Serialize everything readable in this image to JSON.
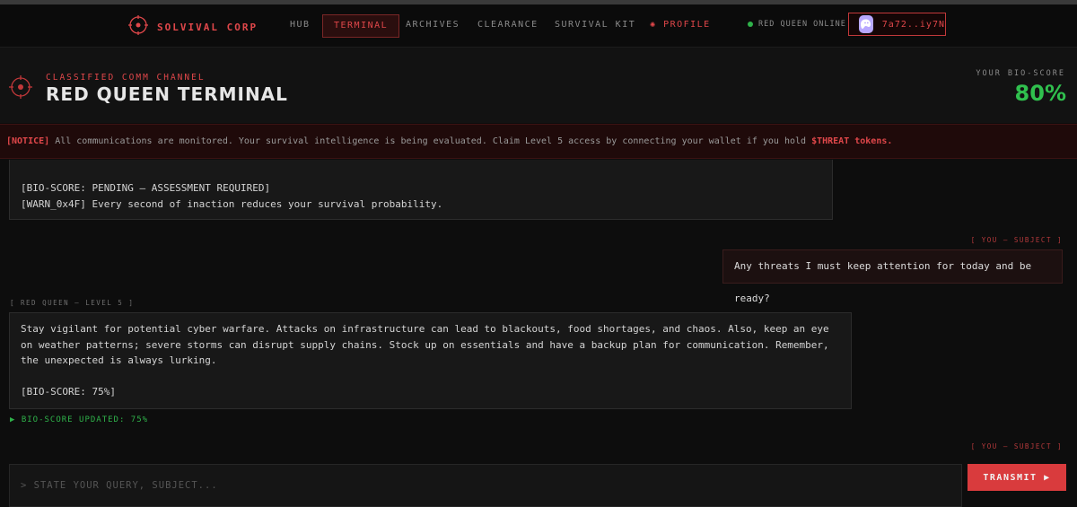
{
  "brand": {
    "name": "SOLVIVAL CORP"
  },
  "nav": {
    "items": [
      {
        "label": "HUB"
      },
      {
        "label": "TERMINAL"
      },
      {
        "label": "ARCHIVES"
      },
      {
        "label": "CLEARANCE"
      },
      {
        "label": "SURVIVAL KIT"
      },
      {
        "label": "PROFILE"
      }
    ],
    "active": "TERMINAL",
    "status": "RED QUEEN ONLINE",
    "wallet": "7a72..iy7N"
  },
  "header": {
    "subtitle": "CLASSIFIED COMM CHANNEL",
    "title": "RED QUEEN TERMINAL",
    "bio_label": "YOUR BIO-SCORE",
    "bio_value": "80%"
  },
  "notice": {
    "tag": "[NOTICE]",
    "text": " All communications are monitored. Your survival intelligence is being evaluated. Claim Level 5 access by connecting your wallet if you hold ",
    "token": "$THREAT tokens."
  },
  "messages": {
    "first_ai": {
      "line1": "[BIO-SCORE: PENDING — ASSESSMENT REQUIRED]",
      "line2": "[WARN_0x4F] Every second of inaction reduces your survival probability."
    },
    "user_label": "[ YOU — SUBJECT ]",
    "user_text": "Any threats I must keep attention for today and be ready?",
    "ai_label": "[ RED QUEEN — LEVEL 5 ]",
    "ai_text": "Stay vigilant for potential cyber warfare. Attacks on infrastructure can lead to blackouts, food shortages, and chaos. Also, keep an eye on weather patterns; severe storms can disrupt supply chains. Stock up on essentials and have a backup plan for communication. Remember, the unexpected is always lurking.",
    "ai_score": "[BIO-SCORE: 75%]",
    "status_update": "▶ BIO-SCORE UPDATED: 75%",
    "user_label_2": "[ YOU — SUBJECT ]"
  },
  "input": {
    "placeholder": "> STATE YOUR QUERY, SUBJECT...",
    "button": "TRANSMIT ▶"
  },
  "colors": {
    "accent": "#e0474a",
    "success": "#30c04e",
    "background": "#0d0d0d"
  }
}
